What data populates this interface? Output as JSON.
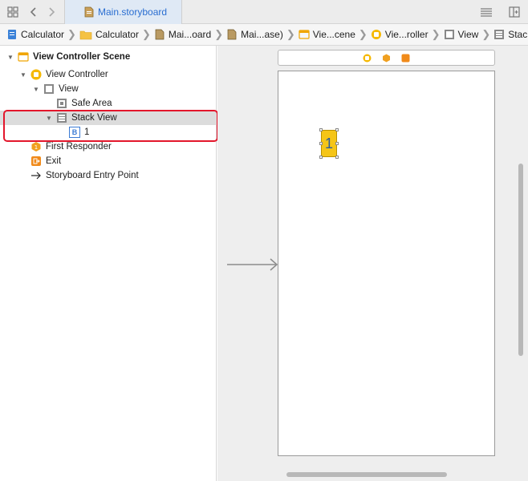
{
  "tab": {
    "label": "Main.storyboard"
  },
  "breadcrumbs": [
    "Calculator",
    "Calculator",
    "Mai...oard",
    "Mai...ase)",
    "Vie...cene",
    "Vie...roller",
    "View",
    "Stack View"
  ],
  "outline": {
    "scene": "View Controller Scene",
    "view_controller": "View Controller",
    "view": "View",
    "safe_area": "Safe Area",
    "stack_view": "Stack View",
    "button": "1",
    "button_badge": "B",
    "first_responder": "First Responder",
    "exit": "Exit",
    "entry_point": "Storyboard Entry Point"
  },
  "canvas": {
    "stack_label": "1"
  },
  "colors": {
    "tab_text": "#2a6ed1",
    "highlight": "#e3162b",
    "stack_fill": "#f5c518",
    "vc_icon": "#f5a623"
  }
}
